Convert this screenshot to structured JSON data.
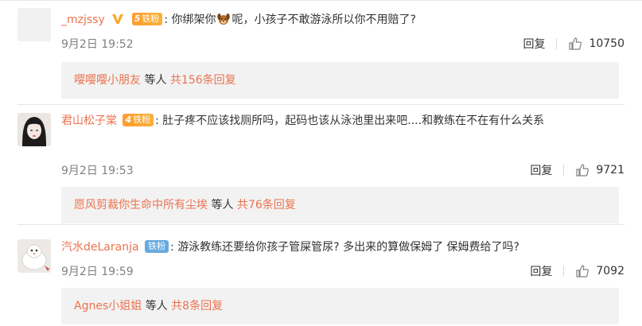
{
  "comments": [
    {
      "username": "_mzjssy",
      "fan_level": "5",
      "fan_label": "铁粉",
      "text_before": "你绑架你",
      "emoji_icon": "dog-face-emoji",
      "text_after": "呢，小孩子不敢游泳所以你不用赔了?",
      "date": "9月2日 19:52",
      "reply_label": "回复",
      "likes": "10750",
      "reply_user": "嘤嘤嘤小朋友",
      "reply_suffix": "等人",
      "reply_count_text": "共156条回复"
    },
    {
      "username": "君山松子棠",
      "fan_level": "4",
      "fan_label": "铁粉",
      "text": "肚子疼不应该找厕所吗，起码也该从泳池里出来吧....和教练在不在有什么关系",
      "date": "9月2日 19:53",
      "reply_label": "回复",
      "likes": "9721",
      "reply_user": "愿风剪裁你生命中所有尘埃",
      "reply_suffix": "等人",
      "reply_count_text": "共76条回复"
    },
    {
      "username": "汽水deLaranja",
      "fan_label": "铁粉",
      "text": "游泳教练还要给你孩子管屎管尿?  多出来的算做保姆了  保姆费给了吗?",
      "date": "9月2日 19:59",
      "reply_label": "回复",
      "likes": "7092",
      "reply_user": "Agnes小姐姐",
      "reply_suffix": "等人",
      "reply_count_text": "共8条回复"
    }
  ],
  "colors": {
    "username": "#eb7350",
    "fan_badge": "#ff9d2e",
    "fan_badge_blue": "#66aadf",
    "reply_box": "#f2f2f2"
  }
}
